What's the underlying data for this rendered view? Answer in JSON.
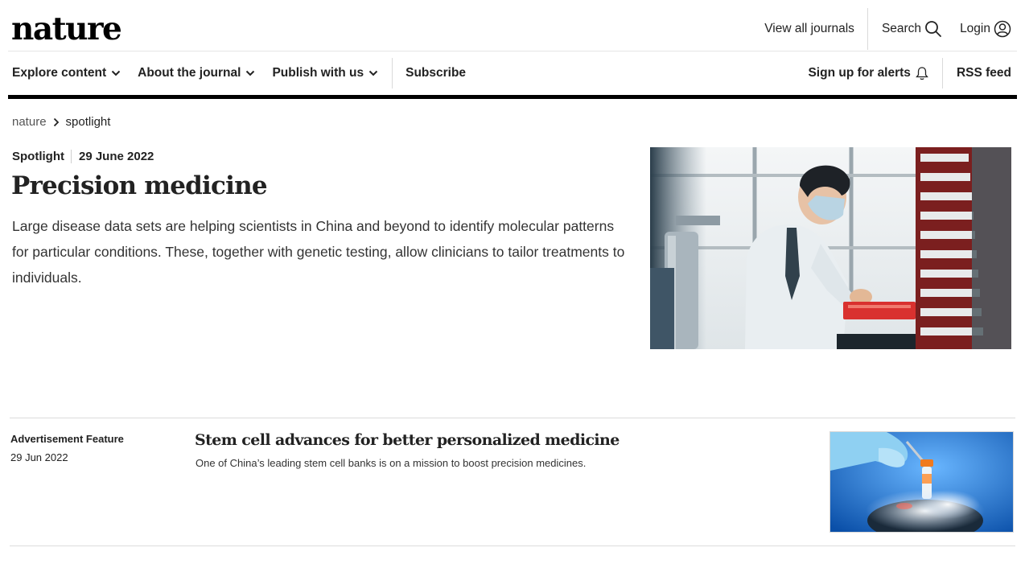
{
  "brand": {
    "logo": "nature"
  },
  "topnav": {
    "view_all_journals": "View all journals",
    "search": "Search",
    "login": "Login"
  },
  "mainnav": {
    "items": [
      {
        "label": "Explore content",
        "has_dropdown": true
      },
      {
        "label": "About the journal",
        "has_dropdown": true
      },
      {
        "label": "Publish with us",
        "has_dropdown": true
      }
    ],
    "subscribe": "Subscribe",
    "alerts": "Sign up for alerts",
    "rss": "RSS feed"
  },
  "breadcrumb": {
    "root": "nature",
    "current": "spotlight"
  },
  "hero": {
    "type": "Spotlight",
    "date": "29 June 2022",
    "title": "Precision medicine",
    "description": "Large disease data sets are helping scientists in China and beyond to identify molecular patterns for particular conditions. These, together with genetic testing, allow clinicians to tailor treatments to individuals."
  },
  "articles": [
    {
      "label": "Advertisement Feature",
      "date": "29 Jun 2022",
      "title": "Stem cell advances for better personalized medicine",
      "description": "One of China’s leading stem cell banks is on a mission to boost precision medicines."
    }
  ],
  "colors": {
    "text": "#222222",
    "rule": "#000000",
    "ad_image_bg": "#1f7fd6"
  }
}
